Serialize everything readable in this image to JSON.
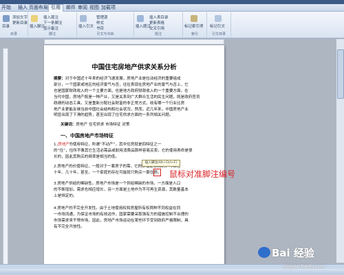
{
  "tabs": [
    "开始",
    "插入",
    "页面布局",
    "引用",
    "邮件",
    "审阅",
    "视图",
    "加载项"
  ],
  "active_tab": "引用",
  "ribbon": {
    "group1": {
      "label": "目录",
      "buttons": [
        "目录",
        "添加文字",
        "更新目录"
      ]
    },
    "group2": {
      "label": "脚注",
      "buttons": [
        "插入脚注",
        "插入尾注",
        "下一条脚注",
        "显示备注"
      ]
    },
    "group3": {
      "label": "引文与书目",
      "buttons": [
        "插入引文",
        "管理源",
        "样式",
        "书目"
      ]
    },
    "group4": {
      "label": "题注",
      "buttons": [
        "插入题注",
        "插入表目录",
        "更新表格",
        "交叉引用"
      ]
    },
    "group5": {
      "label": "索引",
      "buttons": [
        "标记索引项"
      ]
    },
    "group6": {
      "label": "引文目录",
      "buttons": [
        "标记引文"
      ]
    }
  },
  "document": {
    "title": "中国住宅房地产供求关系分析",
    "abstract_label": "摘要：",
    "abstract_lines": [
      "对于中国近十年来的经济飞速发展，房地产业是拉动经济的重要组成",
      "部分，一个国家或地区的经济景气与否，往往表现在房地产业的景气与否上，它",
      "也是国家财政收入的一个主要方面，也是地方政府财政收入的一个重要方面。在",
      "当代中国，房地产既是一种产业，又是关系到广大群众生活的民生问题，既是政府官员",
      "政绩的动态工具，又是重新分配社会财富的非正常方式，收有哪一个行业比房",
      "地产业更能反映当前中国社会结构和社会状况，然而，近几年来，中国房地产业",
      "明显出现了下滑的趋势，甚至出现了住宅供求方面的一系列相关问题。"
    ],
    "keywords_label": "关键词：",
    "keywords": "房地产    住宅供求    市场特征    对策",
    "section1": "一、中国房地产市场特征",
    "para1_lines": [
      "1.房地产的使用特征，所谓“不动产”，其中住房就是四特征之一",
      "的“住”，住所不像其它生活必需品或耐用消费品那样容易买卖，它的使用寿命是很",
      "长的，因此其购买的频率是相当的低。"
    ],
    "para1_red_word": "房地产",
    "para2_lines": [
      "2.房地产的价值特征，一般对于一套房子的需，它的价值是很高的，可以住",
      "十年、几十年，甚至，一个家庭的存在可能就只购买一套住房。"
    ],
    "para3_lines": [
      "3.房地产供给的稀缺性。房地产市场是一个供给稀缺的市场，一方面是人口",
      "的不断增加，需求也相应增长，另一方面是土地作为不可再生资源，其数量基本",
      "上是恒定的。"
    ],
    "para4_lines": [
      "4.房地产的不完全开发性。由于土地使用权和房屋所有权两种不同权益在同",
      "一市场流通，为保证市场的有效运作，国家需要采取强有力的措施控制不合理的",
      "市场需求来干预市场，因此，房地产市场运动在某些环节受到政府严格限制，具",
      "有不完全开放性。"
    ]
  },
  "tooltip": "插入脚注(Alt+Ctrl+F)",
  "annotation": "鼠标对准脚注编号",
  "watermark": {
    "brand": "Bai 经验",
    "url": "jingyan.baidu.com"
  },
  "colors": {
    "annotation_red": "#d9252a",
    "ribbon_blue": "#d9e4f2"
  }
}
